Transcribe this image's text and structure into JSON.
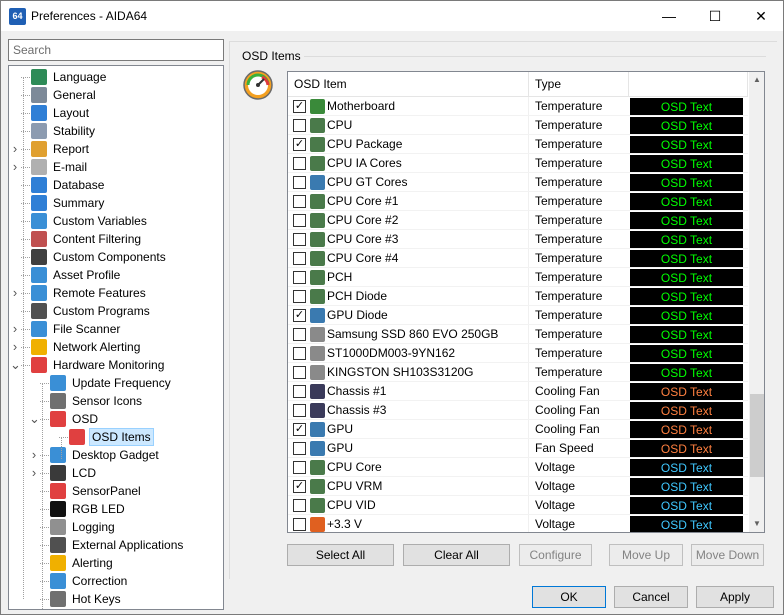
{
  "window": {
    "app_icon_text": "64",
    "title": "Preferences - AIDA64",
    "minimize_glyph": "—",
    "maximize_glyph": "☐",
    "close_glyph": "✕"
  },
  "search": {
    "placeholder": "Search"
  },
  "tree": {
    "items": [
      {
        "label": "Language",
        "icon": "globe-icon",
        "color": "#2e8b57",
        "expander": ""
      },
      {
        "label": "General",
        "icon": "gear-list-icon",
        "color": "#7d8a99",
        "expander": ""
      },
      {
        "label": "Layout",
        "icon": "monitor-icon",
        "color": "#2f7fd6",
        "expander": ""
      },
      {
        "label": "Stability",
        "icon": "gear-icon",
        "color": "#8c9bb0",
        "expander": ""
      },
      {
        "label": "Report",
        "icon": "report-icon",
        "color": "#e0a030",
        "expander": ">"
      },
      {
        "label": "E-mail",
        "icon": "envelope-icon",
        "color": "#b0b0b0",
        "expander": ">"
      },
      {
        "label": "Database",
        "icon": "database-icon",
        "color": "#2f7fd6",
        "expander": ""
      },
      {
        "label": "Summary",
        "icon": "monitor-icon",
        "color": "#2f7fd6",
        "expander": ""
      },
      {
        "label": "Custom Variables",
        "icon": "grid-icon",
        "color": "#3a8fd6",
        "expander": ""
      },
      {
        "label": "Content Filtering",
        "icon": "filter-icon",
        "color": "#c05050",
        "expander": ""
      },
      {
        "label": "Custom Components",
        "icon": "phone-icon",
        "color": "#404040",
        "expander": ""
      },
      {
        "label": "Asset Profile",
        "icon": "network-icon",
        "color": "#3a8fd6",
        "expander": ""
      },
      {
        "label": "Remote Features",
        "icon": "remote-icon",
        "color": "#3a8fd6",
        "expander": ">"
      },
      {
        "label": "Custom Programs",
        "icon": "camera-icon",
        "color": "#505050",
        "expander": ""
      },
      {
        "label": "File Scanner",
        "icon": "magnifier-icon",
        "color": "#3a8fd6",
        "expander": ">"
      },
      {
        "label": "Network Alerting",
        "icon": "warning-icon",
        "color": "#f0b000",
        "expander": ">"
      },
      {
        "label": "Hardware Monitoring",
        "icon": "gauge-icon",
        "color": "#e04040",
        "expander": "v"
      },
      {
        "label": "Update Frequency",
        "icon": "clock-icon",
        "color": "#3a8fd6",
        "expander": ""
      },
      {
        "label": "Sensor Icons",
        "icon": "monitor-icon",
        "color": "#707070",
        "expander": ""
      },
      {
        "label": "OSD",
        "icon": "gauge-icon",
        "color": "#e04040",
        "expander": "v"
      },
      {
        "label": "OSD Items",
        "icon": "gauge-icon",
        "color": "#e04040",
        "expander": ""
      },
      {
        "label": "Desktop Gadget",
        "icon": "gadget-icon",
        "color": "#3a8fd6",
        "expander": ">"
      },
      {
        "label": "LCD",
        "icon": "lcd-icon",
        "color": "#3a3a3a",
        "expander": ">"
      },
      {
        "label": "SensorPanel",
        "icon": "gauge-icon",
        "color": "#e04040",
        "expander": ""
      },
      {
        "label": "RGB LED",
        "icon": "rgb-icon",
        "color": "#111111",
        "expander": ""
      },
      {
        "label": "Logging",
        "icon": "document-icon",
        "color": "#909090",
        "expander": ""
      },
      {
        "label": "External Applications",
        "icon": "camera-icon",
        "color": "#505050",
        "expander": ""
      },
      {
        "label": "Alerting",
        "icon": "warning-icon",
        "color": "#f0b000",
        "expander": ""
      },
      {
        "label": "Correction",
        "icon": "sliders-icon",
        "color": "#3a8fd6",
        "expander": ""
      },
      {
        "label": "Hot Keys",
        "icon": "keyboard-icon",
        "color": "#707070",
        "expander": ""
      }
    ],
    "selected": "OSD Items"
  },
  "panel": {
    "group_title": "OSD Items",
    "columns": {
      "item": "OSD Item",
      "type": "Type"
    },
    "rows": [
      {
        "checked": true,
        "name": "Motherboard",
        "type": "Temperature",
        "osd": "OSD Text",
        "osd_color": "#00ff00",
        "icon": "motherboard-icon",
        "icon_color": "#3a8a3a"
      },
      {
        "checked": false,
        "name": "CPU",
        "type": "Temperature",
        "osd": "OSD Text",
        "osd_color": "#00ff00",
        "icon": "cpu-chip-icon",
        "icon_color": "#4a7a4a"
      },
      {
        "checked": true,
        "name": "CPU Package",
        "type": "Temperature",
        "osd": "OSD Text",
        "osd_color": "#00ff00",
        "icon": "cpu-chip-icon",
        "icon_color": "#4a7a4a"
      },
      {
        "checked": false,
        "name": "CPU IA Cores",
        "type": "Temperature",
        "osd": "OSD Text",
        "osd_color": "#00ff00",
        "icon": "cpu-chip-icon",
        "icon_color": "#4a7a4a"
      },
      {
        "checked": false,
        "name": "CPU GT Cores",
        "type": "Temperature",
        "osd": "OSD Text",
        "osd_color": "#00ff00",
        "icon": "gpu-card-icon",
        "icon_color": "#3a7ab0"
      },
      {
        "checked": false,
        "name": "CPU Core #1",
        "type": "Temperature",
        "osd": "OSD Text",
        "osd_color": "#00ff00",
        "icon": "cpu-chip-icon",
        "icon_color": "#4a7a4a"
      },
      {
        "checked": false,
        "name": "CPU Core #2",
        "type": "Temperature",
        "osd": "OSD Text",
        "osd_color": "#00ff00",
        "icon": "cpu-chip-icon",
        "icon_color": "#4a7a4a"
      },
      {
        "checked": false,
        "name": "CPU Core #3",
        "type": "Temperature",
        "osd": "OSD Text",
        "osd_color": "#00ff00",
        "icon": "cpu-chip-icon",
        "icon_color": "#4a7a4a"
      },
      {
        "checked": false,
        "name": "CPU Core #4",
        "type": "Temperature",
        "osd": "OSD Text",
        "osd_color": "#00ff00",
        "icon": "cpu-chip-icon",
        "icon_color": "#4a7a4a"
      },
      {
        "checked": false,
        "name": "PCH",
        "type": "Temperature",
        "osd": "OSD Text",
        "osd_color": "#00ff00",
        "icon": "cpu-chip-icon",
        "icon_color": "#4a7a4a"
      },
      {
        "checked": false,
        "name": "PCH Diode",
        "type": "Temperature",
        "osd": "OSD Text",
        "osd_color": "#00ff00",
        "icon": "cpu-chip-icon",
        "icon_color": "#4a7a4a"
      },
      {
        "checked": true,
        "name": "GPU Diode",
        "type": "Temperature",
        "osd": "OSD Text",
        "osd_color": "#00ff00",
        "icon": "gpu-card-icon",
        "icon_color": "#3a7ab0"
      },
      {
        "checked": false,
        "name": "Samsung SSD 860 EVO 250GB",
        "type": "Temperature",
        "osd": "OSD Text",
        "osd_color": "#00ff00",
        "icon": "drive-icon",
        "icon_color": "#8a8a8a"
      },
      {
        "checked": false,
        "name": "ST1000DM003-9YN162",
        "type": "Temperature",
        "osd": "OSD Text",
        "osd_color": "#00ff00",
        "icon": "drive-icon",
        "icon_color": "#8a8a8a"
      },
      {
        "checked": false,
        "name": "KINGSTON SH103S3120G",
        "type": "Temperature",
        "osd": "OSD Text",
        "osd_color": "#00ff00",
        "icon": "drive-icon",
        "icon_color": "#8a8a8a"
      },
      {
        "checked": false,
        "name": "Chassis #1",
        "type": "Cooling Fan",
        "osd": "OSD Text",
        "osd_color": "#ff8040",
        "icon": "chassis-icon",
        "icon_color": "#3a3a5a"
      },
      {
        "checked": false,
        "name": "Chassis #3",
        "type": "Cooling Fan",
        "osd": "OSD Text",
        "osd_color": "#ff8040",
        "icon": "chassis-icon",
        "icon_color": "#3a3a5a"
      },
      {
        "checked": true,
        "name": "GPU",
        "type": "Cooling Fan",
        "osd": "OSD Text",
        "osd_color": "#ff8040",
        "icon": "gpu-card-icon",
        "icon_color": "#3a7ab0"
      },
      {
        "checked": false,
        "name": "GPU",
        "type": "Fan Speed",
        "osd": "OSD Text",
        "osd_color": "#ff8040",
        "icon": "gpu-card-icon",
        "icon_color": "#3a7ab0"
      },
      {
        "checked": false,
        "name": "CPU Core",
        "type": "Voltage",
        "osd": "OSD Text",
        "osd_color": "#40c8ff",
        "icon": "cpu-chip-icon",
        "icon_color": "#4a7a4a"
      },
      {
        "checked": true,
        "name": "CPU VRM",
        "type": "Voltage",
        "osd": "OSD Text",
        "osd_color": "#40c8ff",
        "icon": "cpu-chip-icon",
        "icon_color": "#4a7a4a"
      },
      {
        "checked": false,
        "name": "CPU VID",
        "type": "Voltage",
        "osd": "OSD Text",
        "osd_color": "#40c8ff",
        "icon": "cpu-chip-icon",
        "icon_color": "#4a7a4a"
      },
      {
        "checked": false,
        "name": "+3.3 V",
        "type": "Voltage",
        "osd": "OSD Text",
        "osd_color": "#40c8ff",
        "icon": "voltage-icon",
        "icon_color": "#e06020"
      }
    ],
    "scroll_up_glyph": "▲",
    "scroll_down_glyph": "▼"
  },
  "buttons": {
    "select_all": "Select All",
    "clear_all": "Clear All",
    "configure": "Configure",
    "move_up": "Move Up",
    "move_down": "Move Down",
    "ok": "OK",
    "cancel": "Cancel",
    "apply": "Apply"
  }
}
